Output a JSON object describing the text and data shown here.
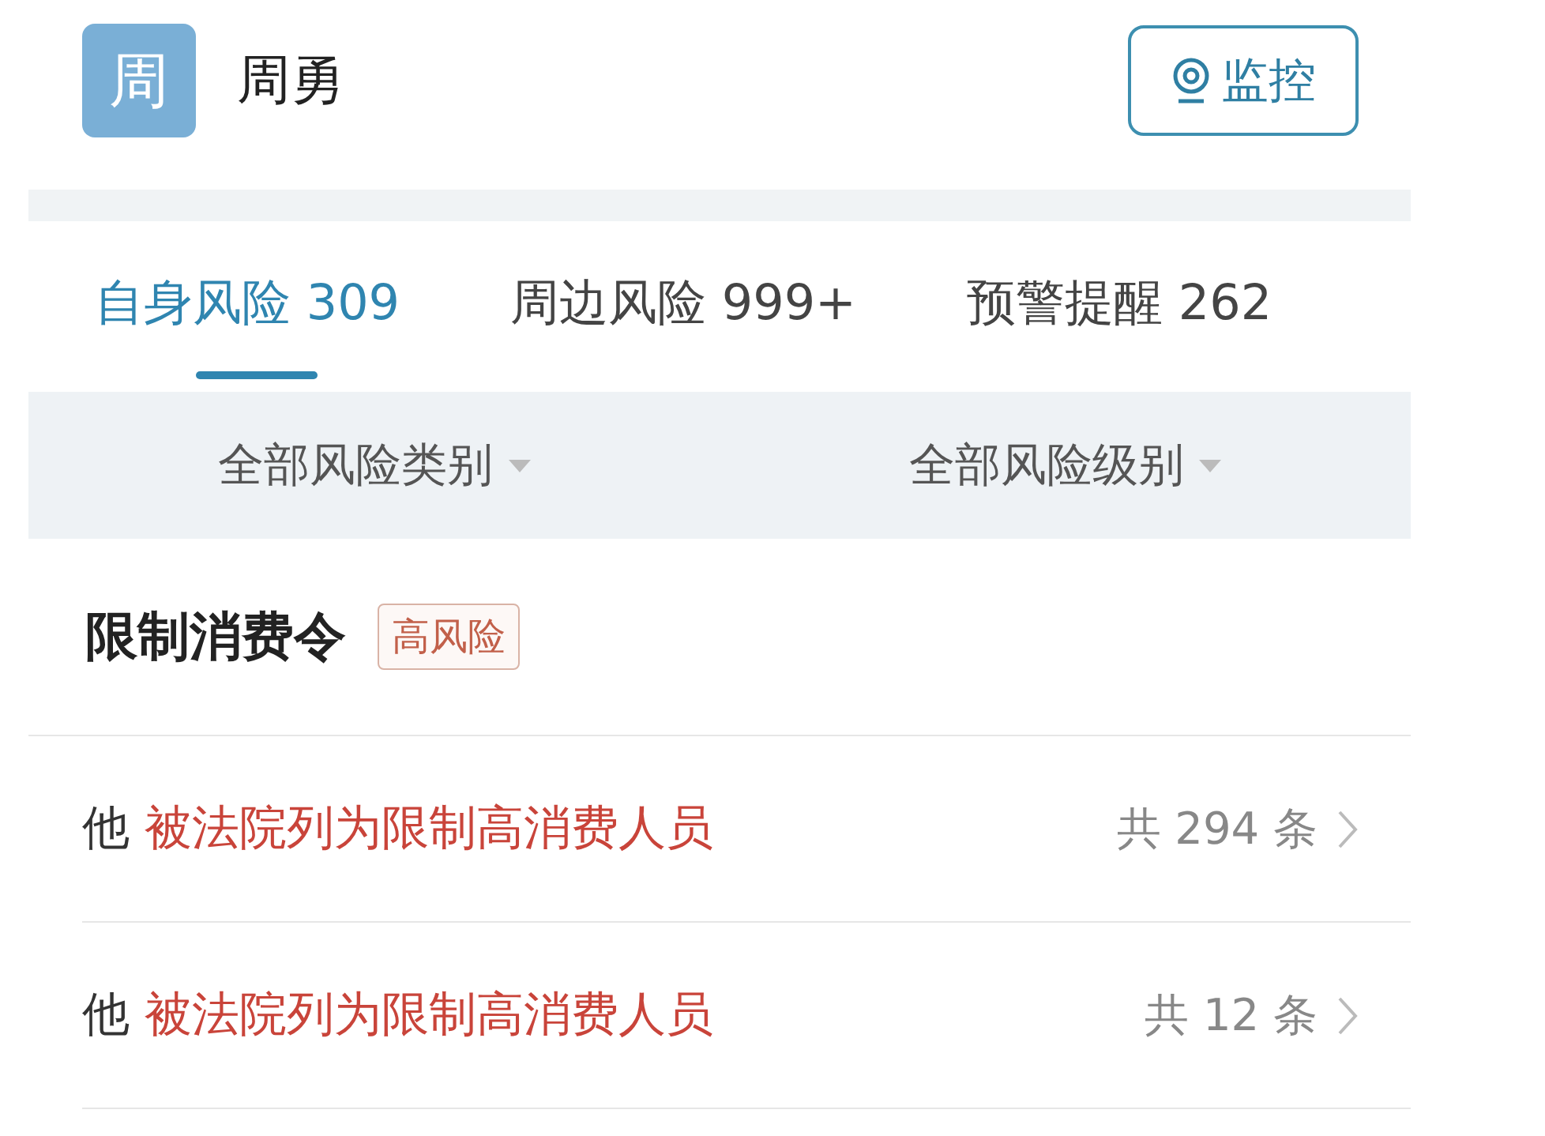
{
  "person": {
    "avatar_char": "周",
    "name": "周勇"
  },
  "monitor_button": {
    "label": "监控"
  },
  "tabs": [
    {
      "label": "自身风险 309",
      "selected": true
    },
    {
      "label": "周边风险 999+",
      "selected": false
    },
    {
      "label": "预警提醒 262",
      "selected": false
    }
  ],
  "filters": [
    {
      "label": "全部风险类别"
    },
    {
      "label": "全部风险级别"
    }
  ],
  "section": {
    "title": "限制消费令",
    "tag": "高风险"
  },
  "rows": [
    {
      "subject": "他",
      "description": "被法院列为限制高消费人员",
      "count": "共 294 条"
    },
    {
      "subject": "他",
      "description": "被法院列为限制高消费人员",
      "count": "共 12 条"
    }
  ]
}
